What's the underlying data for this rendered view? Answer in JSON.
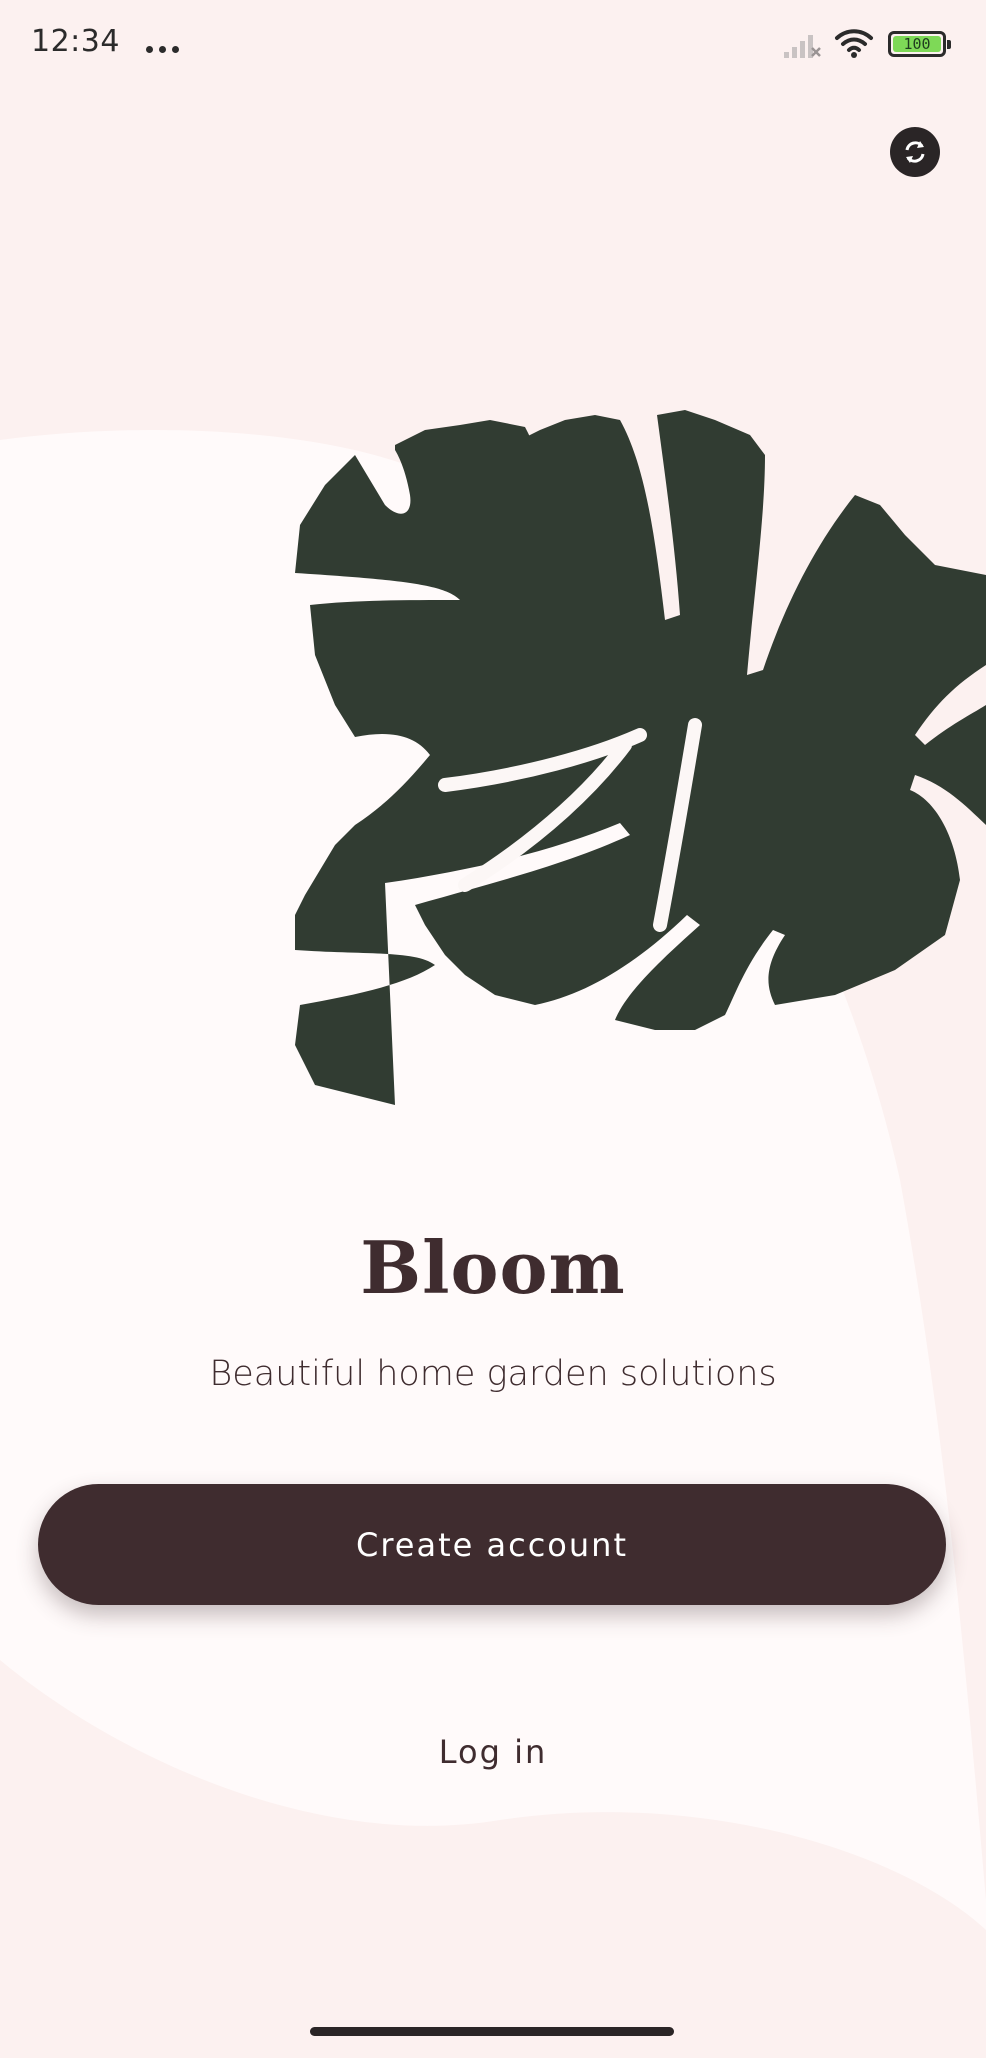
{
  "status_bar": {
    "time": "12:34",
    "battery_level": "100"
  },
  "colors": {
    "background": "#fcf1f0",
    "surface": "#fffafa",
    "primary": "#3f2c2f",
    "leaf": "#313c32"
  },
  "icons": {
    "sync": "sync-icon",
    "signal": "signal-icon",
    "wifi": "wifi-icon",
    "battery": "battery-icon"
  },
  "welcome": {
    "title": "Bloom",
    "subtitle": "Beautiful home garden solutions",
    "create_account_label": "Create account",
    "login_label": "Log in"
  }
}
